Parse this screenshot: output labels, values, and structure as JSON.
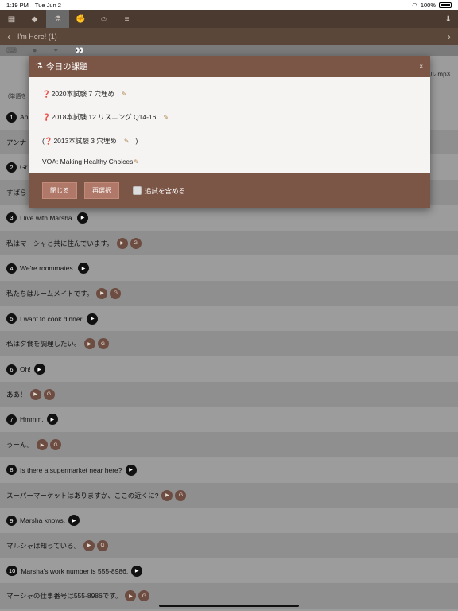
{
  "status": {
    "time": "1:19 PM",
    "date": "Tue Jun 2",
    "battery": "100%"
  },
  "toolbar": {
    "items": [
      {
        "icon": "grid-icon",
        "glyph": "▦"
      },
      {
        "icon": "tag-icon",
        "glyph": "◆"
      },
      {
        "icon": "microscope-icon",
        "glyph": "🔬"
      },
      {
        "icon": "muscle-icon",
        "glyph": "💪"
      },
      {
        "icon": "smiley-icon",
        "glyph": "😐"
      },
      {
        "icon": "menu-icon",
        "glyph": "≡"
      }
    ],
    "right_icon": "download-icon"
  },
  "nav": {
    "title": "I'm Here! (1)"
  },
  "content": {
    "mp3_text": "ル mp3",
    "hint": "(単語を"
  },
  "modal": {
    "title": "今日の課題",
    "tasks": [
      {
        "prefix": "",
        "mark": "❓",
        "text": "2020本試験 7 穴埋め",
        "suffix": ""
      },
      {
        "prefix": "",
        "mark": "❓",
        "text": "2018本試験 12 リスニング Q14-16",
        "suffix": ""
      },
      {
        "prefix": "( ",
        "mark": "❓",
        "text": "2013本試験 3 穴埋め",
        "suffix": " )"
      },
      {
        "prefix": "",
        "mark": "",
        "text": "VOA: Making Healthy Choices",
        "suffix": ""
      }
    ],
    "close_label": "閉じる",
    "reselect_label": "再選択",
    "checkbox_label": "追試を含める",
    "close_glyph": "×"
  },
  "rows": [
    {
      "type": "en",
      "num": "1",
      "text": "An"
    },
    {
      "type": "jp",
      "text": "アンナ"
    },
    {
      "type": "en",
      "num": "2",
      "text": "Gr"
    },
    {
      "type": "jp",
      "text": "すばら"
    },
    {
      "type": "en",
      "num": "3",
      "text": "I live with Marsha."
    },
    {
      "type": "jp",
      "text": "私はマーシャと共に住んでいます。"
    },
    {
      "type": "en",
      "num": "4",
      "text": "We're roommates."
    },
    {
      "type": "jp",
      "text": "私たちはルームメイトです。"
    },
    {
      "type": "en",
      "num": "5",
      "text": "I want to cook dinner."
    },
    {
      "type": "jp",
      "text": "私は夕食を調理したい。"
    },
    {
      "type": "en",
      "num": "6",
      "text": "Oh!"
    },
    {
      "type": "jp",
      "text": "ああ！"
    },
    {
      "type": "en",
      "num": "7",
      "text": "Hmmm."
    },
    {
      "type": "jp",
      "text": "うーん。"
    },
    {
      "type": "en",
      "num": "8",
      "text": "Is there a supermarket near here?"
    },
    {
      "type": "jp",
      "text": "スーパーマーケットはありますか、ここの近くに?"
    },
    {
      "type": "en",
      "num": "9",
      "text": "Marsha knows."
    },
    {
      "type": "jp",
      "text": "マルシャは知っている。"
    },
    {
      "type": "en",
      "num": "10",
      "text": "Marsha's work number is 555-8986."
    },
    {
      "type": "jp",
      "text": "マーシャの仕事番号は555-8986です。"
    }
  ],
  "labels": {
    "g": "G",
    "play": "▶"
  }
}
